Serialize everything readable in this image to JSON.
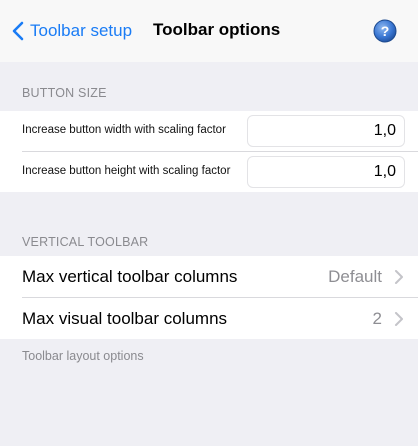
{
  "navbar": {
    "back_label": "Toolbar setup",
    "title": "Toolbar options",
    "help_icon": "question-circle-icon",
    "back_icon": "chevron-left-icon"
  },
  "button_size": {
    "header": "BUTTON SIZE",
    "rows": [
      {
        "label": "Increase button width with scaling factor",
        "value": "1,0"
      },
      {
        "label": "Increase button height with scaling factor",
        "value": "1,0"
      }
    ]
  },
  "vertical_toolbar": {
    "header": "VERTICAL TOOLBAR",
    "rows": [
      {
        "label": "Max vertical toolbar columns",
        "detail": "Default"
      },
      {
        "label": "Max visual toolbar columns",
        "detail": "2"
      }
    ],
    "footer": "Toolbar layout options"
  },
  "colors": {
    "accent": "#1a7cf5",
    "background": "#efeff4",
    "secondary_text": "#8e8e93"
  }
}
